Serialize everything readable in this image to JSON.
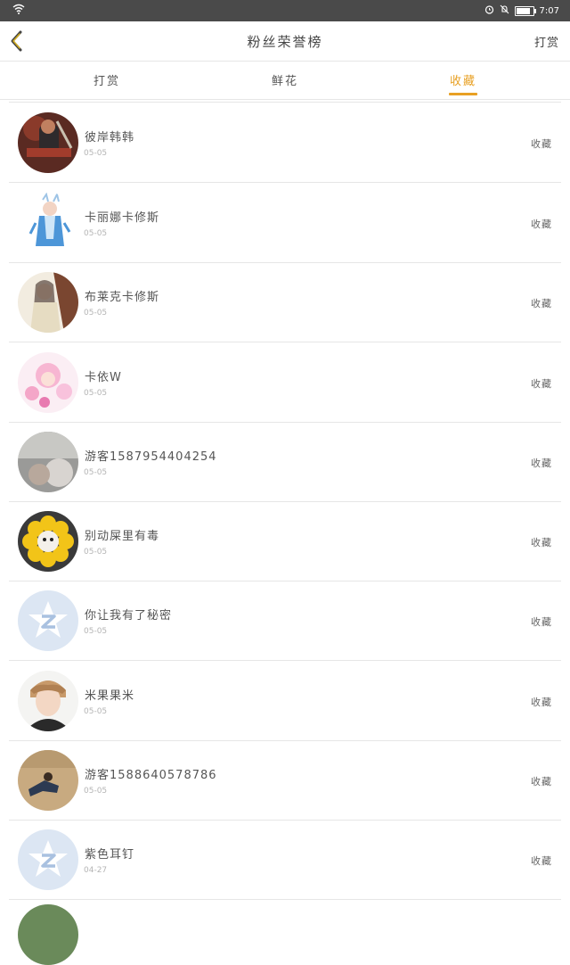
{
  "status_bar": {
    "time": "7:07",
    "battery_level": 0.85
  },
  "nav": {
    "title": "粉丝荣誉榜",
    "action_label": "打赏"
  },
  "tabs": [
    {
      "label": "打赏",
      "active": false
    },
    {
      "label": "鲜花",
      "active": false
    },
    {
      "label": "收藏",
      "active": true
    }
  ],
  "accent_color": "#e8a023",
  "fans": [
    {
      "name": "彼岸韩韩",
      "date": "05-05",
      "action": "收藏",
      "avatar": "warrior-avatar"
    },
    {
      "name": "卡丽娜卡修斯",
      "date": "05-05",
      "action": "收藏",
      "avatar": "anime-character-avatar"
    },
    {
      "name": "布莱克卡修斯",
      "date": "05-05",
      "action": "收藏",
      "avatar": "anime-girl-avatar"
    },
    {
      "name": "卡依W",
      "date": "05-05",
      "action": "收藏",
      "avatar": "pink-anime-avatar"
    },
    {
      "name": "游客1587954404254",
      "date": "05-05",
      "action": "收藏",
      "avatar": "photo-avatar"
    },
    {
      "name": "别动屎里有毒",
      "date": "05-05",
      "action": "收藏",
      "avatar": "sunflower-avatar"
    },
    {
      "name": "你让我有了秘密",
      "date": "05-05",
      "action": "收藏",
      "avatar": "default-qq-avatar"
    },
    {
      "name": "米果果米",
      "date": "05-05",
      "action": "收藏",
      "avatar": "portrait-avatar"
    },
    {
      "name": "游客1588640578786",
      "date": "05-05",
      "action": "收藏",
      "avatar": "beach-photo-avatar"
    },
    {
      "name": "紫色耳钉",
      "date": "04-27",
      "action": "收藏",
      "avatar": "default-qq-avatar"
    }
  ]
}
